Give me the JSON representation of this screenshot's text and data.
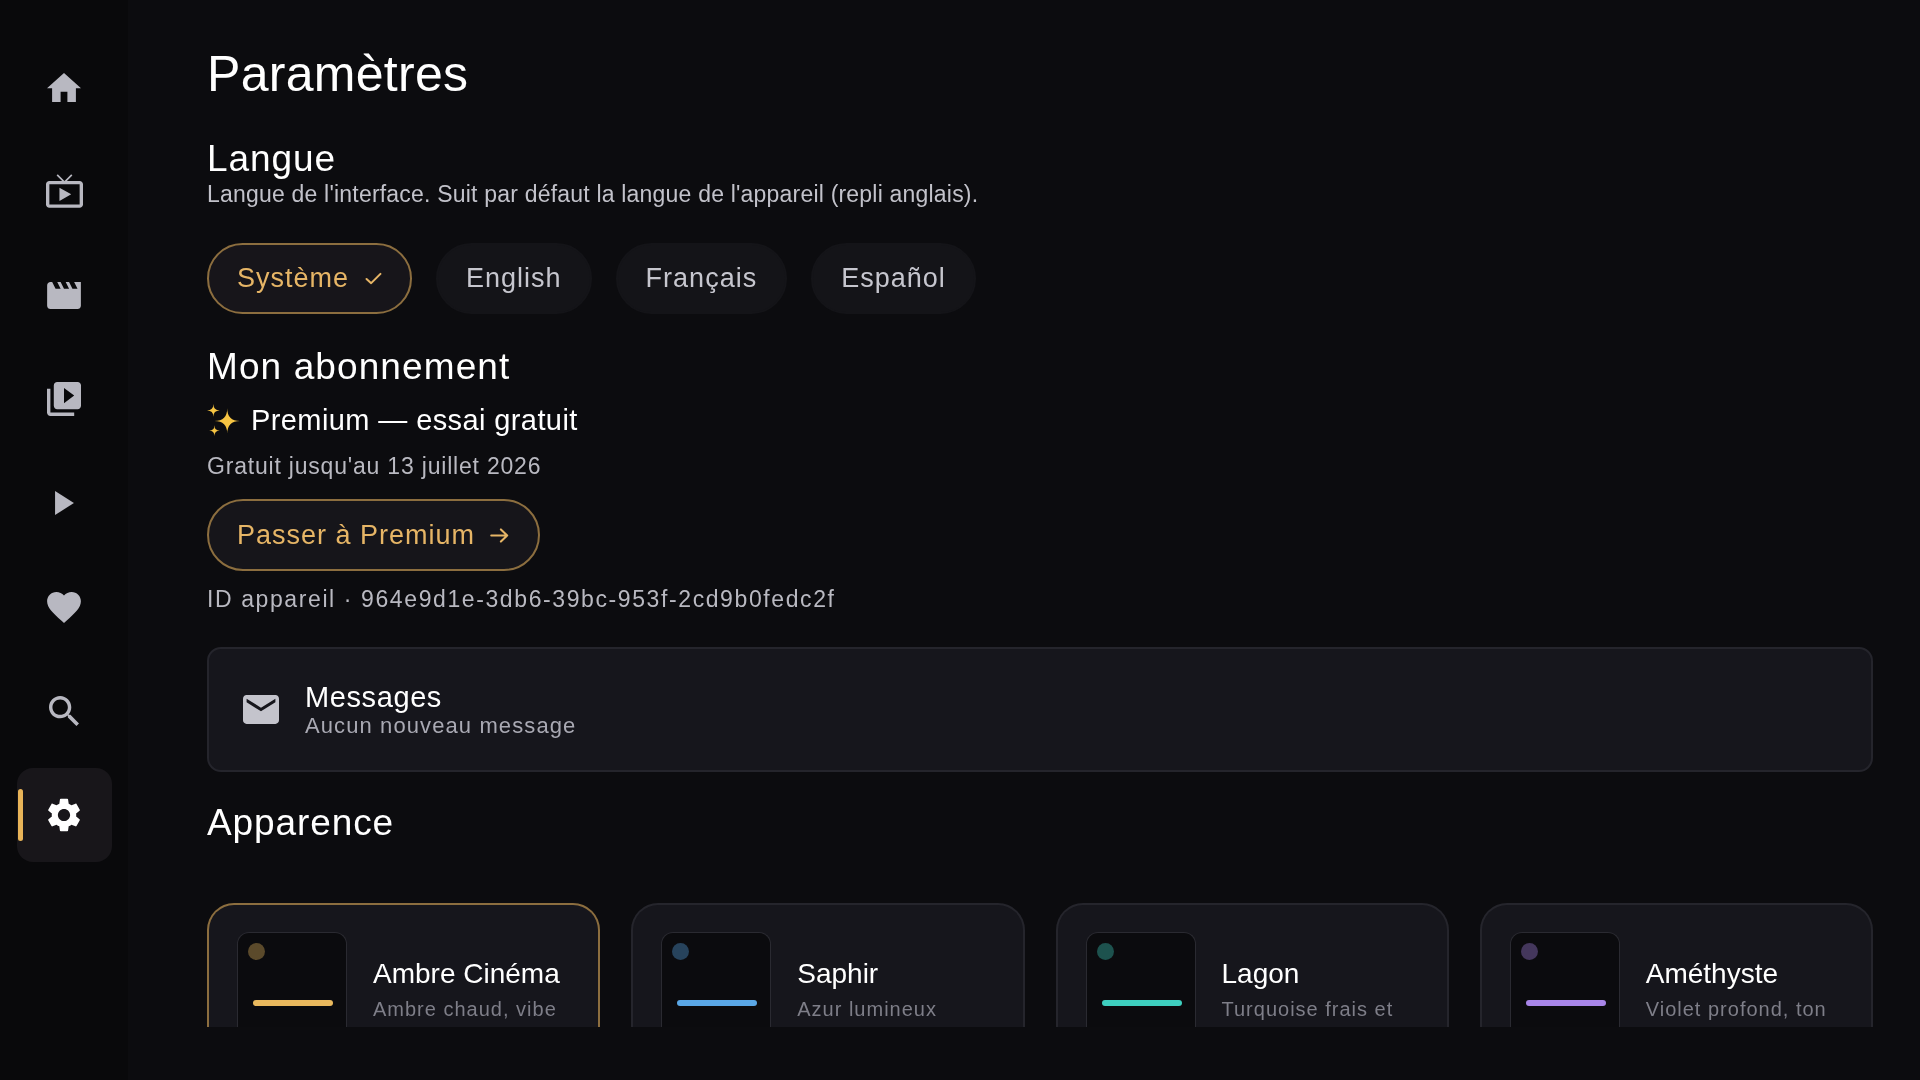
{
  "sidebar": {
    "items": [
      {
        "kind": "home",
        "selected": false
      },
      {
        "kind": "tv",
        "selected": false
      },
      {
        "kind": "clapperboard",
        "selected": false
      },
      {
        "kind": "library",
        "selected": false
      },
      {
        "kind": "play",
        "selected": false
      },
      {
        "kind": "heart",
        "selected": false
      },
      {
        "kind": "search",
        "selected": false
      },
      {
        "kind": "settings",
        "selected": true
      }
    ]
  },
  "page": {
    "title": "Paramètres"
  },
  "language": {
    "heading": "Langue",
    "description": "Langue de l'interface. Suit par défaut la langue de l'appareil (repli anglais).",
    "options": [
      {
        "label": "Système",
        "selected": true
      },
      {
        "label": "English",
        "selected": false
      },
      {
        "label": "Français",
        "selected": false
      },
      {
        "label": "Español",
        "selected": false
      }
    ]
  },
  "subscription": {
    "heading": "Mon abonnement",
    "plan": "Premium — essai gratuit",
    "validity": "Gratuit jusqu'au 13 juillet 2026",
    "upgrade_button": "Passer à Premium",
    "device_id": "ID appareil · 964e9d1e-3db6-39bc-953f-2cd9b0fedc2f"
  },
  "messages": {
    "title": "Messages",
    "status": "Aucun nouveau message"
  },
  "appearance": {
    "heading": "Apparence",
    "themes": [
      {
        "name": "Ambre Cinéma",
        "description": "Ambre chaud, vibe",
        "color": "#e9b95e",
        "selected": true
      },
      {
        "name": "Saphir",
        "description": "Azur lumineux",
        "color": "#5aa7e6",
        "selected": false
      },
      {
        "name": "Lagon",
        "description": "Turquoise frais et",
        "color": "#3ecfbf",
        "selected": false
      },
      {
        "name": "Améthyste",
        "description": "Violet profond, ton",
        "color": "#a885e8",
        "selected": false
      }
    ]
  }
}
